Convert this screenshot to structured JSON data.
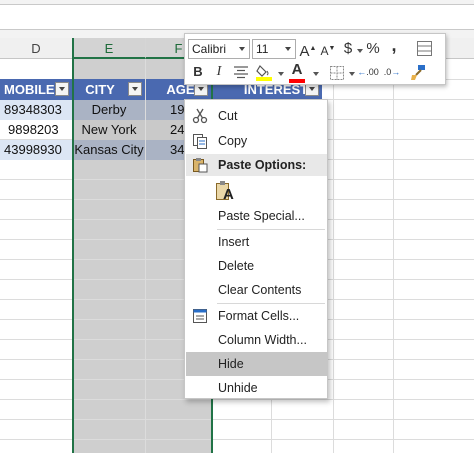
{
  "columns": {
    "d": "D",
    "e": "E",
    "f": "F"
  },
  "table": {
    "headers": {
      "mobile": "MOBILE",
      "city": "CITY",
      "age": "AGE",
      "interest": "INTEREST"
    },
    "rows": [
      {
        "mobile": "89348303",
        "city": "Derby",
        "age": "19"
      },
      {
        "mobile": "9898203",
        "city": "New York",
        "age": "24"
      },
      {
        "mobile": "43998930",
        "city": "Kansas City",
        "age": "34"
      }
    ]
  },
  "mini_toolbar": {
    "font_name": "Calibri",
    "font_size": "11",
    "grow_font": "A",
    "shrink_font": "A",
    "currency": "$",
    "percent": "%",
    "comma": ",",
    "bold": "B",
    "italic": "I",
    "font_color": "A",
    "increase_decimal": ".00",
    "decrease_decimal": ".0",
    "colors": {
      "fill": "#ffff00",
      "font": "#ff0000"
    }
  },
  "context_menu": {
    "cut": "Cut",
    "copy": "Copy",
    "paste_options": "Paste Options:",
    "paste_icon_letter": "A",
    "paste_special": "Paste Special...",
    "insert": "Insert",
    "delete": "Delete",
    "clear_contents": "Clear Contents",
    "format_cells": "Format Cells...",
    "column_width": "Column Width...",
    "hide": "Hide",
    "unhide": "Unhide"
  },
  "colors": {
    "table_header": "#4a69b0",
    "row_band": "#dce6f4",
    "selection_border": "#217346",
    "menu_highlight": "#c6c6c6"
  }
}
